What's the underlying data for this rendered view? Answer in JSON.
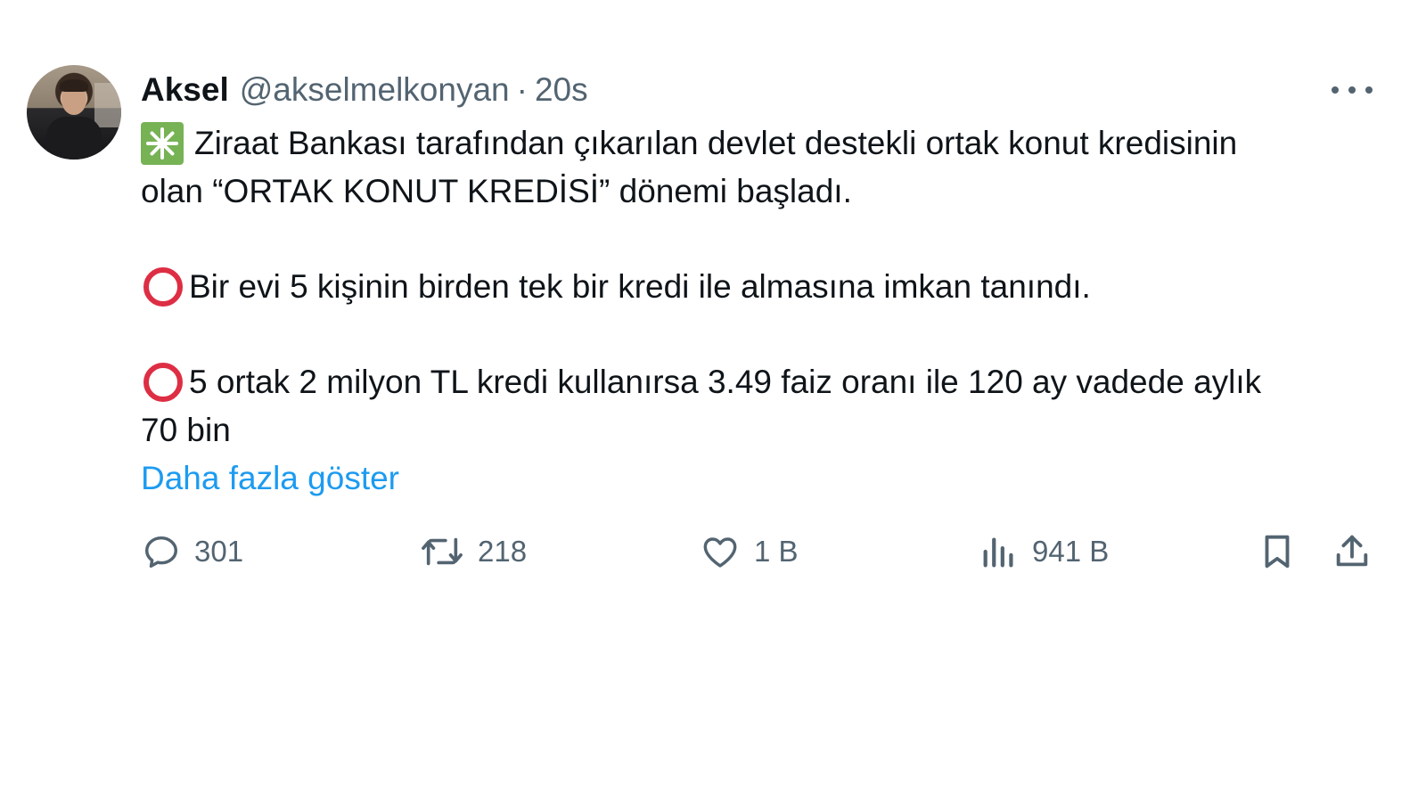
{
  "tweet": {
    "author_name": "Aksel",
    "author_handle": "@akselmelkonyan",
    "separator": "·",
    "time": "20s",
    "lines": [
      "Ziraat Bankası tarafından çıkarılan devlet destekli ortak konut kredisinin",
      "olan “ORTAK KONUT KREDİSİ” dönemi başladı.",
      "Bir evi 5 kişinin birden tek bir kredi ile almasına imkan tanındı.",
      "5 ortak 2 milyon TL kredi kullanırsa 3.49 faiz oranı ile 120 ay vadede aylık",
      "70 bin"
    ],
    "show_more": "Daha fazla göster"
  },
  "actions": {
    "reply_count": "301",
    "retweet_count": "218",
    "like_count": "1 B",
    "views_count": "941 B"
  },
  "icons": {
    "sparkle": "eight-spoked-asterisk-icon",
    "bullet": "hollow-red-circle-icon",
    "reply": "reply-icon",
    "retweet": "retweet-icon",
    "like": "heart-icon",
    "views": "analytics-icon",
    "bookmark": "bookmark-icon",
    "share": "share-icon",
    "more": "more-options-icon"
  },
  "colors": {
    "link": "#1d9bf0",
    "secondary_text": "#536471",
    "primary_text": "#0f1419",
    "sparkle_bg": "#77b255",
    "bullet_red": "#dd2e44"
  }
}
